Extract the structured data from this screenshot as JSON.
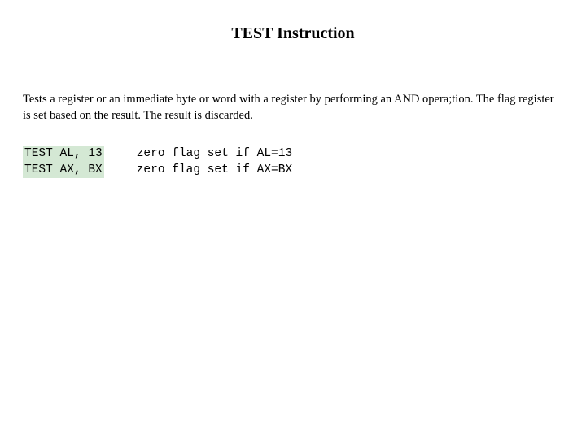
{
  "title": "TEST Instruction",
  "description": "Tests a register or an immediate byte or word with a register by performing an AND opera;tion. The flag register is set based on the result. The result is discarded.",
  "code": {
    "left": "TEST AL, 13\nTEST AX, BX",
    "right": "zero flag set if AL=13\nzero flag set if AX=BX"
  }
}
